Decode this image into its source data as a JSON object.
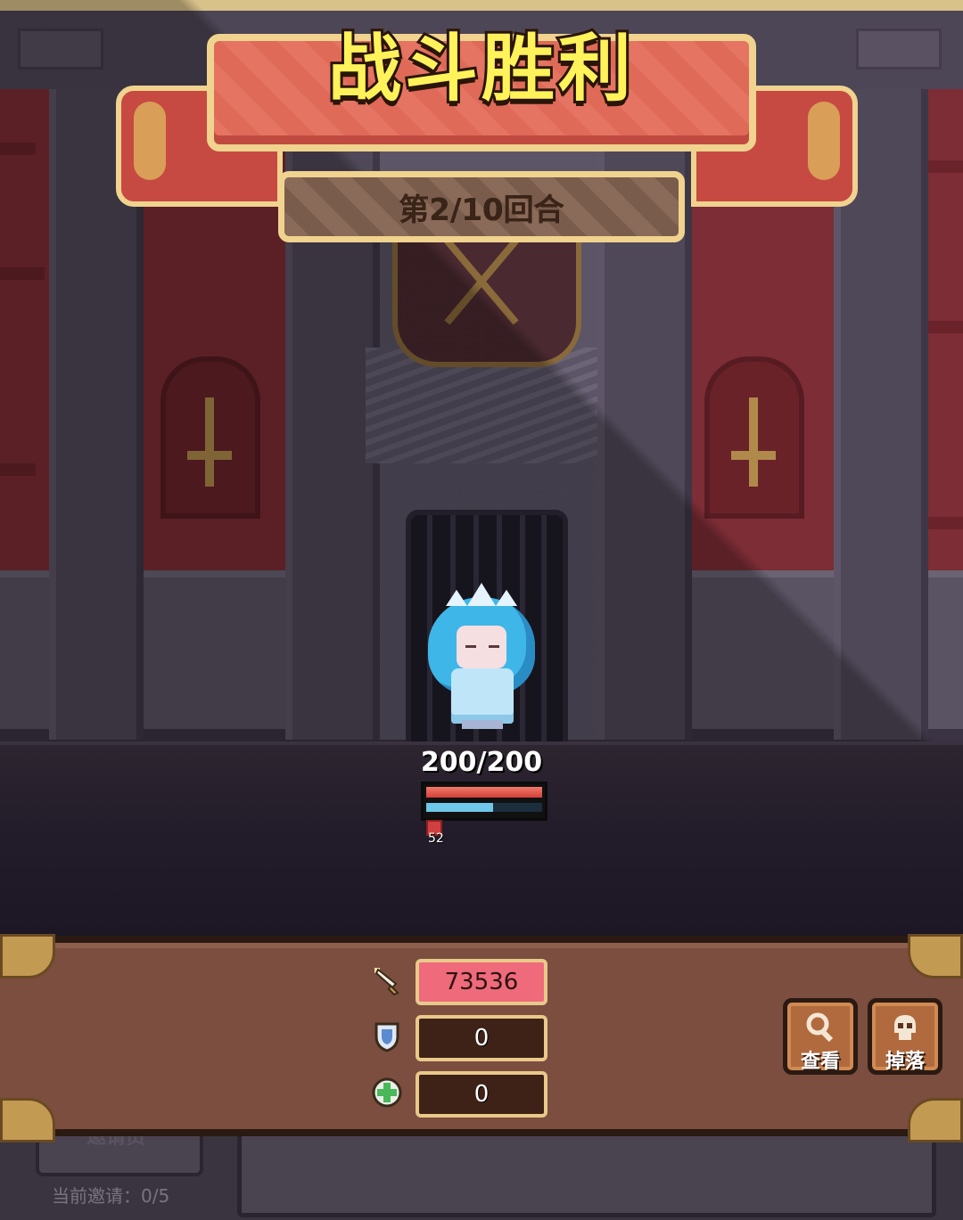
{
  "battle": {
    "title": "战斗胜利",
    "round_label": "第2/10回合"
  },
  "hero": {
    "hp_text": "200/200",
    "hp_fraction": 1.0,
    "mana_fraction": 0.58,
    "buff_count": "52"
  },
  "stats": [
    {
      "icon": "sword-icon",
      "value": "73536",
      "highlight": true
    },
    {
      "icon": "shield-icon",
      "value": "0",
      "highlight": false
    },
    {
      "icon": "heal-icon",
      "value": "0",
      "highlight": false
    }
  ],
  "actions": {
    "view_label": "查看",
    "view_icon": "magnifier-icon",
    "drop_label": "掉落",
    "drop_icon": "skull-icon"
  },
  "invite": {
    "button_label": "邀请员",
    "status": "当前邀请：0/5"
  },
  "colors": {
    "title_fill": "#fff25a",
    "banner_red": "#e57462",
    "gold_trim": "#f0d38e",
    "panel_brown": "#7b4e3f",
    "attack_highlight": "#ef6a7a"
  }
}
